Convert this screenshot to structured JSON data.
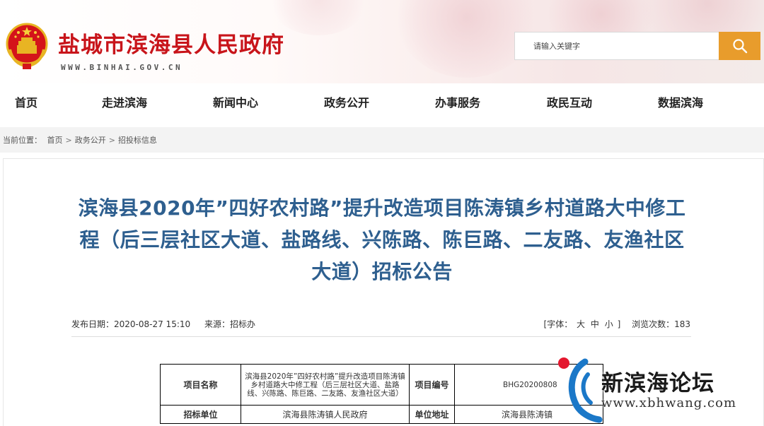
{
  "site": {
    "title": "盐城市滨海县人民政府",
    "url": "WWW.BINHAI.GOV.CN"
  },
  "search": {
    "placeholder": "请输入关键字",
    "button_icon": "search-icon"
  },
  "nav": {
    "items": [
      {
        "label": "首页"
      },
      {
        "label": "走进滨海"
      },
      {
        "label": "新闻中心"
      },
      {
        "label": "政务公开"
      },
      {
        "label": "办事服务"
      },
      {
        "label": "政民互动"
      },
      {
        "label": "数据滨海"
      }
    ]
  },
  "breadcrumb": {
    "prefix": "当前位置：",
    "items": [
      "首页",
      "政务公开",
      "招投标信息"
    ],
    "separator": ">"
  },
  "article": {
    "title": "滨海县2020年”四好农村路”提升改造项目陈涛镇乡村道路大中修工程（后三层社区大道、盐路线、兴陈路、陈巨路、二友路、友渔社区大道）招标公告",
    "publish_date": "发布日期：2020-08-27 15:10",
    "source": "来源：招标办",
    "font_size_label": "[字体：",
    "font_sizes": [
      "大",
      "中",
      "小"
    ],
    "font_size_close": "]",
    "views": "浏览次数：183"
  },
  "table": {
    "row1": {
      "label1": "项目名称",
      "value1": "滨海县2020年”四好农村路”提升改造项目陈涛镇乡村道路大中修工程（后三层社区大道、盐路线、兴陈路、陈巨路、二友路、友渔社区大道）",
      "label2": "项目编号",
      "value2": "BHG20200808"
    },
    "row2": {
      "label1": "招标单位",
      "value1": "滨海县陈涛镇人民政府",
      "label2": "单位地址",
      "value2": "滨海县陈涛镇"
    }
  },
  "watermark": {
    "text": "新滨海论坛",
    "url": "www.xbhwang.com"
  },
  "colors": {
    "brand_red": "#c8141a",
    "search_button": "#e89c2c",
    "title_blue": "#2e5f8f"
  }
}
